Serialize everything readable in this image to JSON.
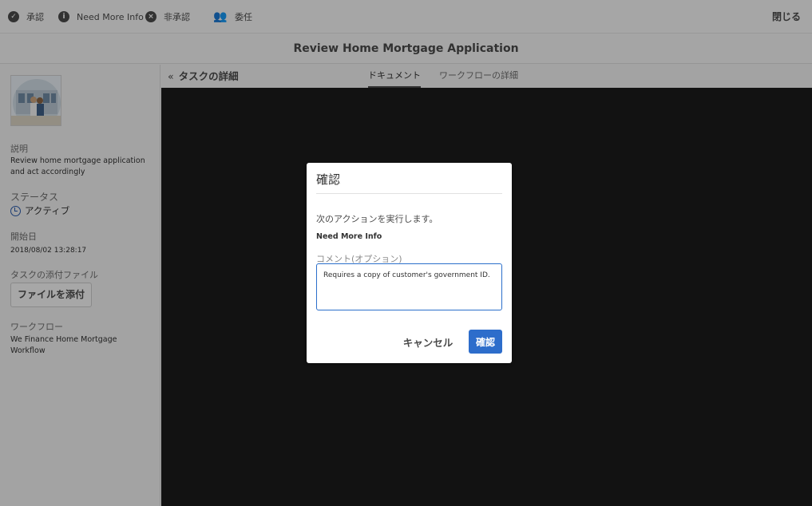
{
  "toolbar": {
    "actions": [
      {
        "label": "承認",
        "icon": "check-icon"
      },
      {
        "label": "Need More Info",
        "icon": "info-icon"
      },
      {
        "label": "非承認",
        "icon": "close-circle-icon"
      },
      {
        "label": "委任",
        "icon": "delegate-people-icon"
      }
    ],
    "close_label": "閉じる"
  },
  "header": {
    "title": "Review Home Mortgage Application"
  },
  "sidebar": {
    "description_label": "説明",
    "description": "Review home mortgage application and act accordingly",
    "status_label": "ステータス",
    "status": "アクティブ",
    "start_date_label": "開始日",
    "start_date": "2018/08/02 13:28:17",
    "attachments_label": "タスクの添付ファイル",
    "attach_button": "ファイルを添付",
    "workflow_label": "ワークフロー",
    "workflow": "We Finance Home Mortgage Workflow"
  },
  "details": {
    "back_label": "タスクの詳細",
    "tabs": [
      {
        "label": "ドキュメント",
        "active": true
      },
      {
        "label": "ワークフローの詳細",
        "active": false
      }
    ]
  },
  "dialog": {
    "title": "確認",
    "message": "次のアクションを実行します。",
    "action": "Need More Info",
    "comment_label": "コメント(オプション)",
    "comment_value": "Requires a copy of customer's government ID.",
    "cancel_label": "キャンセル",
    "confirm_label": "確認"
  },
  "colors": {
    "accent": "#2d6dcb",
    "document_bg": "#1b1b1b"
  }
}
